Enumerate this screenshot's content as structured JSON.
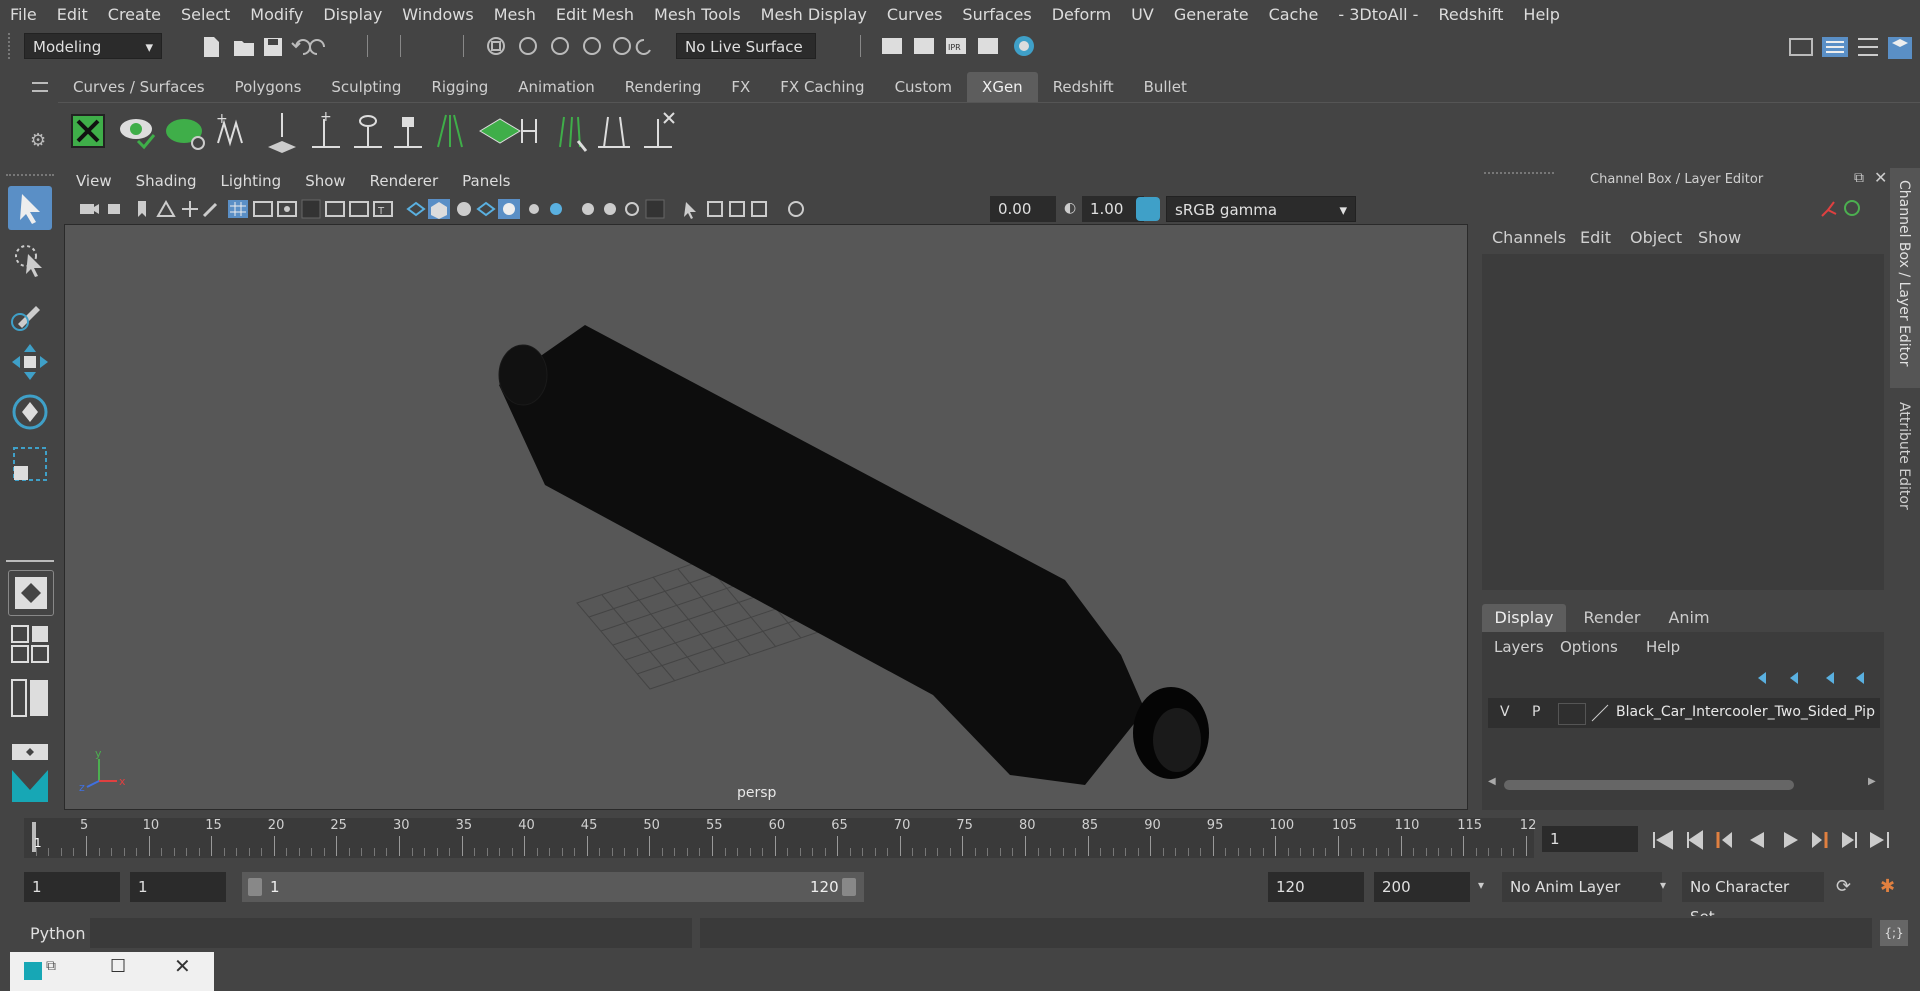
{
  "menubar": [
    "File",
    "Edit",
    "Create",
    "Select",
    "Modify",
    "Display",
    "Windows",
    "Mesh",
    "Edit Mesh",
    "Mesh Tools",
    "Mesh Display",
    "Curves",
    "Surfaces",
    "Deform",
    "UV",
    "Generate",
    "Cache",
    "- 3DtoAll -",
    "Redshift",
    "Help"
  ],
  "status": {
    "mode": "Modeling",
    "live_surface": "No Live Surface"
  },
  "shelf_tabs": [
    "Curves / Surfaces",
    "Polygons",
    "Sculpting",
    "Rigging",
    "Animation",
    "Rendering",
    "FX",
    "FX Caching",
    "Custom",
    "XGen",
    "Redshift",
    "Bullet"
  ],
  "active_shelf_tab": "XGen",
  "viewport": {
    "menu": [
      "View",
      "Shading",
      "Lighting",
      "Show",
      "Renderer",
      "Panels"
    ],
    "exposure": "0.00",
    "gamma": "1.00",
    "color_space": "sRGB gamma",
    "camera_label": "persp",
    "axis_x": "x",
    "axis_y": "y",
    "axis_z": "z"
  },
  "channel_box": {
    "title": "Channel Box / Layer Editor",
    "menu": [
      "Channels",
      "Edit",
      "Object",
      "Show"
    ],
    "side_tab_1": "Channel Box / Layer Editor",
    "side_tab_2": "Attribute Editor"
  },
  "layer_editor": {
    "tabs": [
      "Display",
      "Render",
      "Anim"
    ],
    "active_tab": "Display",
    "menu": [
      "Layers",
      "Options",
      "Help"
    ],
    "layer": {
      "v": "V",
      "p": "P",
      "name": "Black_Car_Intercooler_Two_Sided_Pip"
    }
  },
  "timeline": {
    "ticks": [
      "5",
      "10",
      "15",
      "20",
      "25",
      "30",
      "35",
      "40",
      "45",
      "50",
      "55",
      "60",
      "65",
      "70",
      "75",
      "80",
      "85",
      "90",
      "95",
      "100",
      "105",
      "110",
      "115",
      "12"
    ],
    "start_marker": "1",
    "current_frame": "1"
  },
  "range": {
    "start": "1",
    "playback_start": "1",
    "slider_start": "1",
    "slider_end": "120",
    "playback_end": "120",
    "end": "200",
    "anim_layer": "No Anim Layer",
    "char_set": "No Character Set"
  },
  "command": {
    "language": "Python"
  },
  "colors": {
    "accent": "#5a8fc6",
    "xgen_green": "#3fae49",
    "bg": "#444444",
    "viewport_bg": "#575757"
  }
}
